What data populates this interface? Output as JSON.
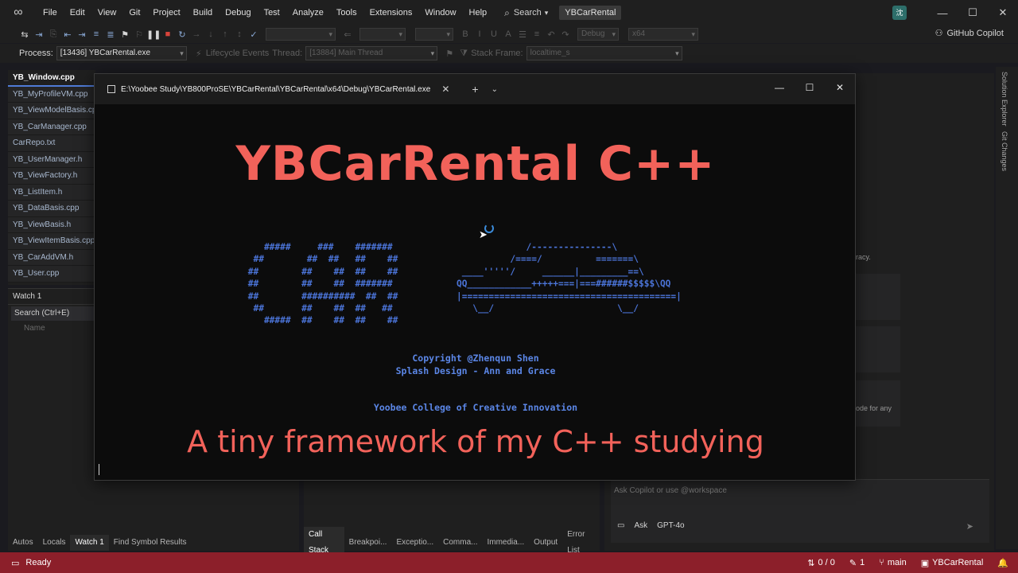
{
  "titlebar": {
    "menu": [
      "File",
      "Edit",
      "View",
      "Git",
      "Project",
      "Build",
      "Debug",
      "Test",
      "Analyze",
      "Tools",
      "Extensions",
      "Window",
      "Help"
    ],
    "search_label": "Search",
    "solution_name": "YBCarRental",
    "account_initial": "沈"
  },
  "toolbar": {
    "config": "Debug",
    "platform": "x64",
    "copilot_label": "GitHub Copilot"
  },
  "debug_bar": {
    "process_label": "Process:",
    "process_value": "[13436] YBCarRental.exe",
    "lifecycle_label": "Lifecycle Events",
    "thread_label": "Thread:",
    "thread_value": "[13884] Main Thread",
    "stack_label": "Stack Frame:",
    "stack_value": "localtime_s"
  },
  "editor_tabs": [
    {
      "label": "YB_Window.cpp",
      "active": true
    },
    {
      "label": "YB_MyProfileVM.cpp",
      "active": false
    },
    {
      "label": "YB_ViewModelBasis.cpp",
      "active": false
    },
    {
      "label": "YB_CarManager.cpp",
      "active": false
    },
    {
      "label": "CarRepo.txt",
      "active": false
    },
    {
      "label": "YB_UserManager.h",
      "active": false
    },
    {
      "label": "YB_ViewFactory.h",
      "active": false
    },
    {
      "label": "YB_ListItem.h",
      "active": false
    },
    {
      "label": "YB_DataBasis.cpp",
      "active": false
    },
    {
      "label": "YB_ViewBasis.h",
      "active": false
    },
    {
      "label": "YB_ViewItemBasis.cpp",
      "active": false
    },
    {
      "label": "YB_CarAddVM.h",
      "active": false
    },
    {
      "label": "YB_User.cpp",
      "active": false
    }
  ],
  "watch": {
    "title": "Watch 1",
    "search": "Search (Ctrl+E)",
    "col_name": "Name"
  },
  "bottom_tabs_left": [
    "Autos",
    "Locals",
    "Watch 1",
    "Find Symbol Results"
  ],
  "bottom_tabs_mid": [
    "Call Stack",
    "Breakpoi...",
    "Exceptio...",
    "Comma...",
    "Immedia...",
    "Output",
    "Error List"
  ],
  "copilot": {
    "frag1": "racy.",
    "frag2": "ode for any",
    "placeholder": "Ask Copilot or use @workspace",
    "mode": "Ask",
    "model": "GPT-4o"
  },
  "side_strip": [
    "Solution Explorer",
    "Git Changes"
  ],
  "terminal": {
    "tab_title": "E:\\Yoobee Study\\YB800ProSE\\YBCarRental\\YBCarRental\\x64\\Debug\\YBCarRental.exe",
    "big_title": "YBCarRental C++",
    "ascii_car_word": "    #####     ###    #######\n  ##        ##  ##   ##    ##\n ##        ##    ##  ##    ##\n ##        ##    ##  #######\n ##        ##########  ##  ##\n  ##       ##    ##  ##   ##\n    #####  ##    ##  ##    ##",
    "ascii_car_art": "             /---------------\\\n          /====/          =======\\\n ____'''''/     ______|_________==\\\nQQ____________+++++===|===######$$$$$\\QQ\n|========================================|\n   \\__/                       \\__/",
    "copyright": "Copyright @Zhenqun Shen",
    "design": "Splash Design - Ann and Grace",
    "college": "Yoobee College of Creative Innovation",
    "tagline": "A tiny framework of my C++ studying"
  },
  "statusbar": {
    "status": "Ready",
    "errors": "0 / 0",
    "changes": "1",
    "branch": "main",
    "repo": "YBCarRental"
  },
  "colors": {
    "title_red": "#f2625a",
    "ascii_blue": "#4b74d8",
    "status_bg": "#8c1f2a"
  }
}
